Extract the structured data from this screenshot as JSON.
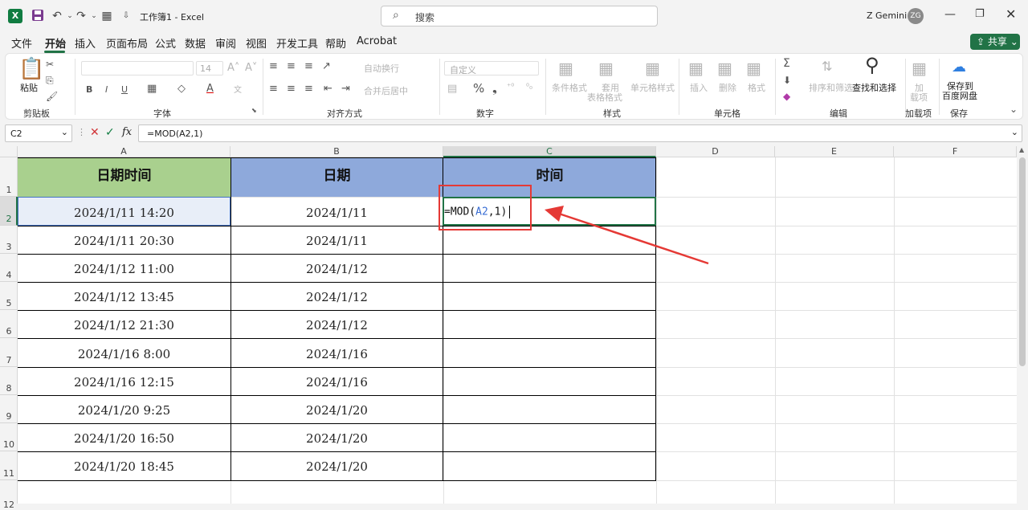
{
  "titlebar": {
    "doc_title": "工作簿1 - Excel",
    "search_placeholder": "搜索",
    "user_name": "Z Gemini",
    "user_initials": "ZG",
    "app_logo": "X"
  },
  "menu": [
    "文件",
    "开始",
    "插入",
    "页面布局",
    "公式",
    "数据",
    "审阅",
    "视图",
    "开发工具",
    "帮助",
    "Acrobat"
  ],
  "share_label": "共享",
  "ribbon": {
    "paste": "粘贴",
    "clipboard": "剪贴板",
    "font_size": "14",
    "font": "字体",
    "bold": "B",
    "italic": "I",
    "underline": "U",
    "wrap_text": "自动换行",
    "merge_center": "合并后居中",
    "alignment": "对齐方式",
    "number_format": "自定义",
    "number": "数字",
    "conditional_format": "条件格式",
    "table_format_1": "套用",
    "table_format_2": "表格格式",
    "cell_style": "单元格样式",
    "styles": "样式",
    "insert": "插入",
    "delete": "删除",
    "format": "格式",
    "cells": "单元格",
    "sort_filter": "排序和筛选",
    "find_select": "查找和选择",
    "editing": "编辑",
    "addin_1": "加",
    "addin_2": "载项",
    "addins": "加载项",
    "save_to_1": "保存到",
    "save_to_2": "百度网盘",
    "save": "保存",
    "percent": "%",
    "sigma": "Σ"
  },
  "formula_bar": {
    "name_box": "C2",
    "formula": "=MOD(A2,1)",
    "fx": "fx"
  },
  "columns": [
    "A",
    "B",
    "C",
    "D",
    "E",
    "F"
  ],
  "rows": [
    "1",
    "2",
    "3",
    "4",
    "5",
    "6",
    "7",
    "8",
    "9",
    "10",
    "11",
    "12"
  ],
  "headers": [
    "日期时间",
    "日期",
    "时间"
  ],
  "table": [
    [
      "2024/1/11 14:20",
      "2024/1/11"
    ],
    [
      "2024/1/11 20:30",
      "2024/1/11"
    ],
    [
      "2024/1/12 11:00",
      "2024/1/12"
    ],
    [
      "2024/1/12 13:45",
      "2024/1/12"
    ],
    [
      "2024/1/12 21:30",
      "2024/1/12"
    ],
    [
      "2024/1/16 8:00",
      "2024/1/16"
    ],
    [
      "2024/1/16 12:15",
      "2024/1/16"
    ],
    [
      "2024/1/20 9:25",
      "2024/1/20"
    ],
    [
      "2024/1/20 16:50",
      "2024/1/20"
    ],
    [
      "2024/1/20 18:45",
      "2024/1/20"
    ]
  ],
  "edit": {
    "prefix": "=MOD(",
    "ref": "A2",
    "suffix": ",1)"
  },
  "colors": {
    "header_a": "#a9d08e",
    "header_bc": "#8ea9db",
    "accent": "#217346",
    "annotation": "#e53935",
    "ref": "#3b6fd4"
  }
}
